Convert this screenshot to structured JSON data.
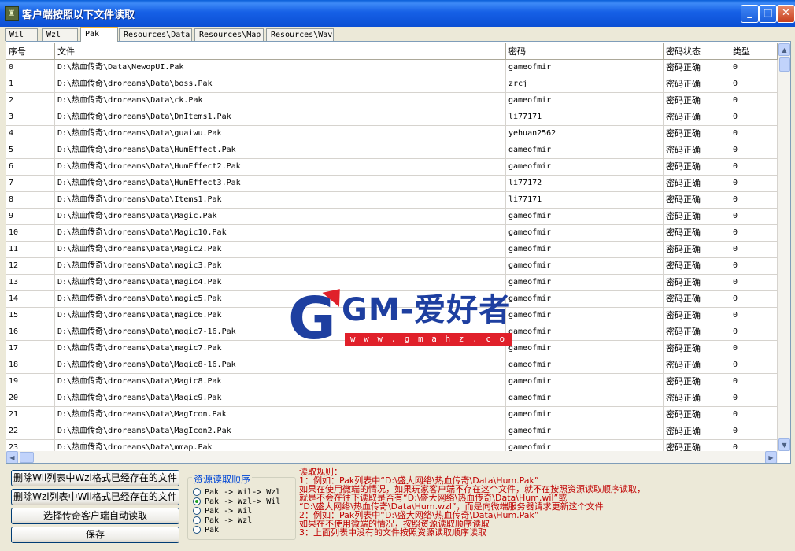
{
  "window": {
    "title": "客户端按照以下文件读取",
    "app_icon": "game-client-icon"
  },
  "tabs": [
    "Wil",
    "Wzl",
    "Pak",
    "Resources\\Data",
    "Resources\\Map",
    "Resources\\Wav"
  ],
  "selected_tab": "Pak",
  "table": {
    "columns": [
      "序号",
      "文件",
      "密码",
      "密码状态",
      "类型"
    ],
    "rows": [
      {
        "no": "0",
        "file": "D:\\热血传奇\\Data\\NewopUI.Pak",
        "password": "gameofmir",
        "status": "密码正确",
        "type": "0"
      },
      {
        "no": "1",
        "file": "D:\\热血传奇\\droreams\\Data\\boss.Pak",
        "password": "zrcj",
        "status": "密码正确",
        "type": "0"
      },
      {
        "no": "2",
        "file": "D:\\热血传奇\\droreams\\Data\\ck.Pak",
        "password": "gameofmir",
        "status": "密码正确",
        "type": "0"
      },
      {
        "no": "3",
        "file": "D:\\热血传奇\\droreams\\Data\\DnItems1.Pak",
        "password": "li77171",
        "status": "密码正确",
        "type": "0"
      },
      {
        "no": "4",
        "file": "D:\\热血传奇\\droreams\\Data\\guaiwu.Pak",
        "password": "yehuan2562",
        "status": "密码正确",
        "type": "0"
      },
      {
        "no": "5",
        "file": "D:\\热血传奇\\droreams\\Data\\HumEffect.Pak",
        "password": "gameofmir",
        "status": "密码正确",
        "type": "0"
      },
      {
        "no": "6",
        "file": "D:\\热血传奇\\droreams\\Data\\HumEffect2.Pak",
        "password": "gameofmir",
        "status": "密码正确",
        "type": "0"
      },
      {
        "no": "7",
        "file": "D:\\热血传奇\\droreams\\Data\\HumEffect3.Pak",
        "password": "li77172",
        "status": "密码正确",
        "type": "0"
      },
      {
        "no": "8",
        "file": "D:\\热血传奇\\droreams\\Data\\Items1.Pak",
        "password": "li77171",
        "status": "密码正确",
        "type": "0"
      },
      {
        "no": "9",
        "file": "D:\\热血传奇\\droreams\\Data\\Magic.Pak",
        "password": "gameofmir",
        "status": "密码正确",
        "type": "0"
      },
      {
        "no": "10",
        "file": "D:\\热血传奇\\droreams\\Data\\Magic10.Pak",
        "password": "gameofmir",
        "status": "密码正确",
        "type": "0"
      },
      {
        "no": "11",
        "file": "D:\\热血传奇\\droreams\\Data\\Magic2.Pak",
        "password": "gameofmir",
        "status": "密码正确",
        "type": "0"
      },
      {
        "no": "12",
        "file": "D:\\热血传奇\\droreams\\Data\\magic3.Pak",
        "password": "gameofmir",
        "status": "密码正确",
        "type": "0"
      },
      {
        "no": "13",
        "file": "D:\\热血传奇\\droreams\\Data\\magic4.Pak",
        "password": "gameofmir",
        "status": "密码正确",
        "type": "0"
      },
      {
        "no": "14",
        "file": "D:\\热血传奇\\droreams\\Data\\magic5.Pak",
        "password": "gameofmir",
        "status": "密码正确",
        "type": "0"
      },
      {
        "no": "15",
        "file": "D:\\热血传奇\\droreams\\Data\\magic6.Pak",
        "password": "gameofmir",
        "status": "密码正确",
        "type": "0"
      },
      {
        "no": "16",
        "file": "D:\\热血传奇\\droreams\\Data\\magic7-16.Pak",
        "password": "gameofmir",
        "status": "密码正确",
        "type": "0"
      },
      {
        "no": "17",
        "file": "D:\\热血传奇\\droreams\\Data\\magic7.Pak",
        "password": "gameofmir",
        "status": "密码正确",
        "type": "0"
      },
      {
        "no": "18",
        "file": "D:\\热血传奇\\droreams\\Data\\Magic8-16.Pak",
        "password": "gameofmir",
        "status": "密码正确",
        "type": "0"
      },
      {
        "no": "19",
        "file": "D:\\热血传奇\\droreams\\Data\\Magic8.Pak",
        "password": "gameofmir",
        "status": "密码正确",
        "type": "0"
      },
      {
        "no": "20",
        "file": "D:\\热血传奇\\droreams\\Data\\Magic9.Pak",
        "password": "gameofmir",
        "status": "密码正确",
        "type": "0"
      },
      {
        "no": "21",
        "file": "D:\\热血传奇\\droreams\\Data\\MagIcon.Pak",
        "password": "gameofmir",
        "status": "密码正确",
        "type": "0"
      },
      {
        "no": "22",
        "file": "D:\\热血传奇\\droreams\\Data\\MagIcon2.Pak",
        "password": "gameofmir",
        "status": "密码正确",
        "type": "0"
      },
      {
        "no": "23",
        "file": "D:\\热血传奇\\droreams\\Data\\mmap.Pak",
        "password": "gameofmir",
        "status": "密码正确",
        "type": "0"
      }
    ]
  },
  "watermark": {
    "brand": "GM-爱好者",
    "url": "w w w . g m a h z . c o m",
    "letter": "G"
  },
  "buttons": {
    "delete_wil": "删除Wil列表中Wzl格式已经存在的文件",
    "delete_wzl": "删除Wzl列表中Wil格式已经存在的文件",
    "auto_read": "选择传奇客户端自动读取",
    "save": "保存"
  },
  "resource_order": {
    "title": "资源读取顺序",
    "options": [
      "Pak -> Wil-> Wzl",
      "Pak -> Wzl-> Wil",
      "Pak -> Wil",
      "Pak -> Wzl",
      "Pak"
    ],
    "selected_index": 1
  },
  "rules": {
    "title": "读取规则：",
    "lines": [
      "1：例如：Pak列表中“D:\\盛大网络\\热血传奇\\Data\\Hum.Pak”",
      "   如果在使用微端的情况，如果玩家客户端不存在这个文件，就不在按照资源读取顺序读取，",
      "   就是不会在往下读取是否有“D:\\盛大网络\\热血传奇\\Data\\Hum.wil”或",
      "   “D:\\盛大网络\\热血传奇\\Data\\Hum.wzl”，而是向微端服务器请求更新这个文件",
      "2：例如：Pak列表中“D:\\盛大网络\\热血传奇\\Data\\Hum.Pak”",
      "   如果在不使用微端的情况，按照资源读取顺序读取",
      "3：上面列表中没有的文件按照资源读取顺序读取"
    ]
  },
  "colors": {
    "accent": "#0A5FD8",
    "rules_text": "#C00000",
    "group_title": "#0046D5",
    "active_tab": "#F9B935"
  }
}
